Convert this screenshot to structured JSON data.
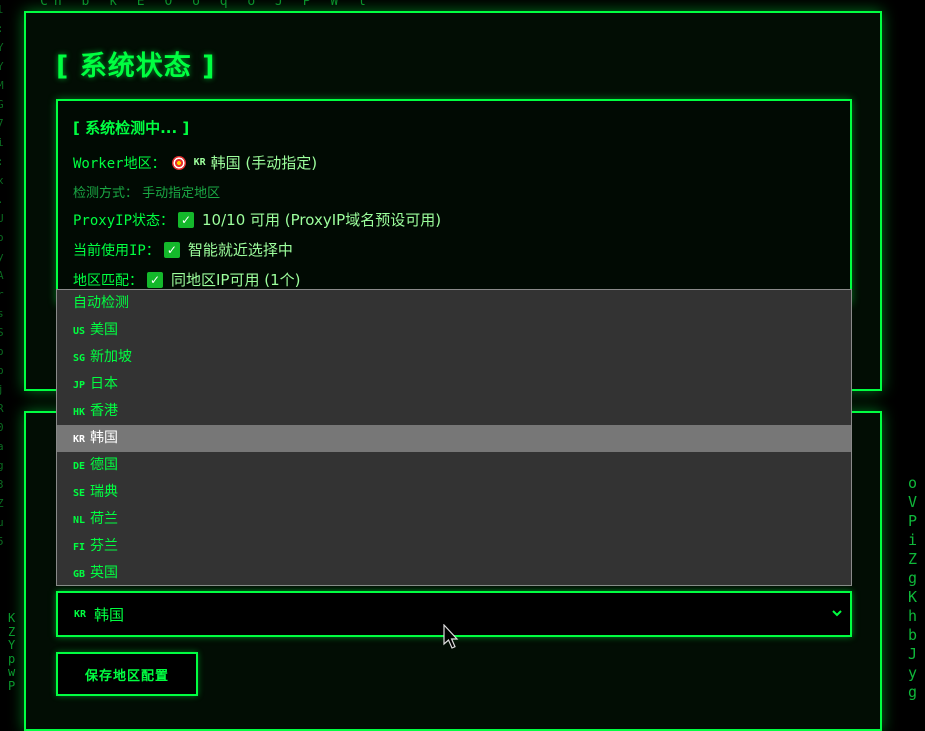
{
  "background": {
    "top_row": "Cn  b    k E O  o   q   o   J   P    W   l",
    "right_column": [
      "o",
      "V",
      "P",
      "i",
      "Z",
      "g",
      "K",
      "h",
      "b",
      "J",
      "y",
      "g"
    ],
    "left_column": [
      "K",
      "Z",
      "Y",
      "p",
      "w",
      "P"
    ]
  },
  "page_title": "[ 系统状态 ]",
  "status": {
    "heading": "[ 系统检测中... ]",
    "worker_region_label": "Worker地区：",
    "worker_region_code": "KR",
    "worker_region_value": "韩国 (手动指定)",
    "detect_method": "检测方式：  手动指定地区",
    "proxyip_label": "ProxyIP状态：",
    "proxyip_value": "10/10 可用 (ProxyIP域名预设可用)",
    "current_ip_label": "当前使用IP：",
    "current_ip_value": "智能就近选择中",
    "region_match_label": "地区匹配：",
    "region_match_value": "同地区IP可用 (1个)"
  },
  "region_options": [
    {
      "code": "",
      "label": "自动检测"
    },
    {
      "code": "US",
      "label": "美国"
    },
    {
      "code": "SG",
      "label": "新加坡"
    },
    {
      "code": "JP",
      "label": "日本"
    },
    {
      "code": "HK",
      "label": "香港"
    },
    {
      "code": "KR",
      "label": "韩国",
      "selected": true
    },
    {
      "code": "DE",
      "label": "德国"
    },
    {
      "code": "SE",
      "label": "瑞典"
    },
    {
      "code": "NL",
      "label": "荷兰"
    },
    {
      "code": "FI",
      "label": "芬兰"
    },
    {
      "code": "GB",
      "label": "英国"
    }
  ],
  "region_select": {
    "code": "KR",
    "label": "韩国"
  },
  "save_button": "保存地区配置",
  "colors": {
    "accent": "#00ff41",
    "background": "#000000",
    "dropdown_bg": "#333333",
    "selected_option": "#777777"
  }
}
